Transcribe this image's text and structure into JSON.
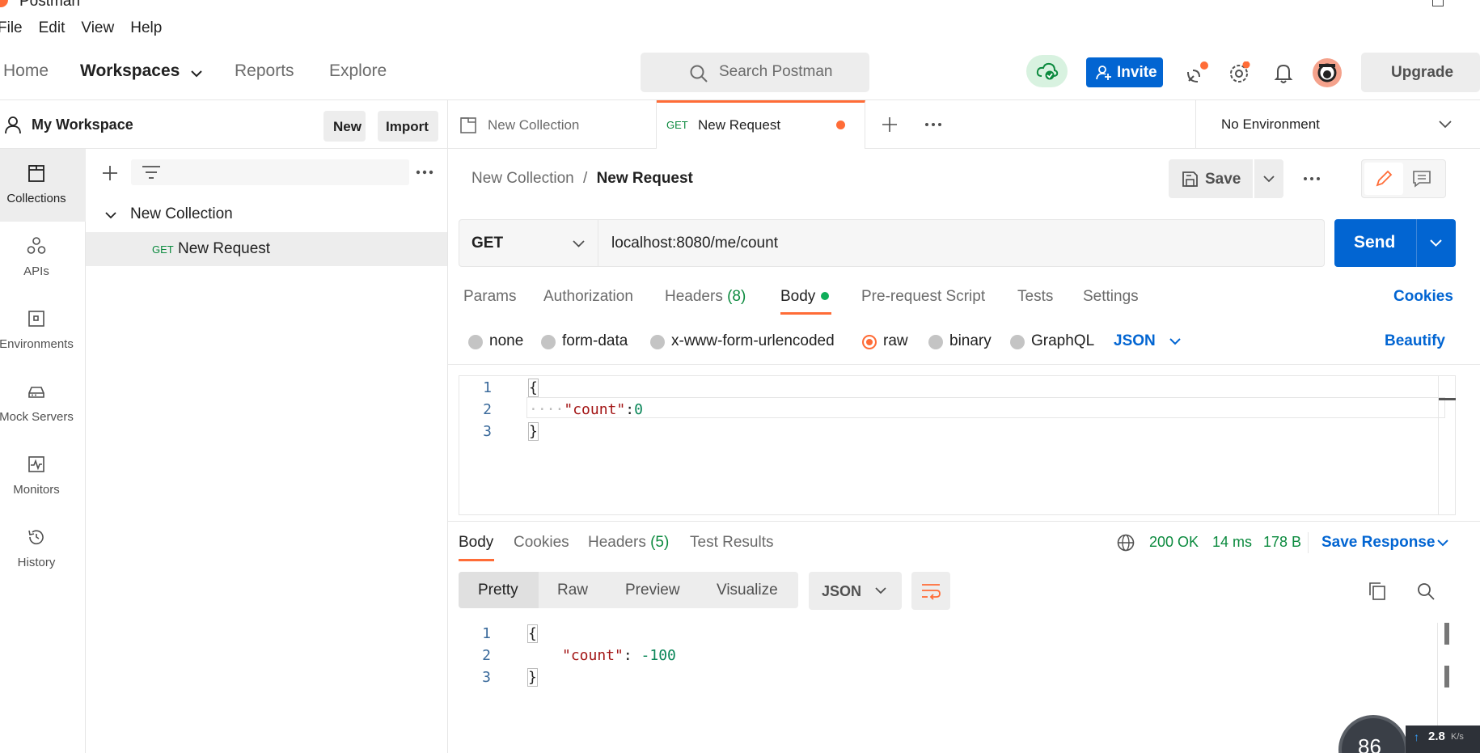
{
  "app": {
    "title": "Postman"
  },
  "menu": [
    "File",
    "Edit",
    "View",
    "Help"
  ],
  "header": {
    "nav": {
      "home": "Home",
      "workspaces": "Workspaces",
      "reports": "Reports",
      "explore": "Explore"
    },
    "search_placeholder": "Search Postman",
    "invite_label": "Invite",
    "upgrade_label": "Upgrade"
  },
  "workspace": {
    "name": "My Workspace",
    "new_label": "New",
    "import_label": "Import"
  },
  "rail": {
    "collections": "Collections",
    "apis": "APIs",
    "environments": "Environments",
    "mock_servers": "Mock Servers",
    "monitors": "Monitors",
    "history": "History"
  },
  "tree": {
    "collection": "New Collection",
    "request_method": "GET",
    "request_name": "New Request"
  },
  "tabs": {
    "tab1": "New Collection",
    "tab2_method": "GET",
    "tab2": "New Request",
    "environment": "No Environment"
  },
  "request": {
    "breadcrumb_parent": "New Collection",
    "breadcrumb_sep": "/",
    "breadcrumb_current": "New Request",
    "save_label": "Save",
    "method": "GET",
    "url": "localhost:8080/me/count",
    "send_label": "Send",
    "subtabs": {
      "params": "Params",
      "authorization": "Authorization",
      "headers": "Headers",
      "headers_count": "(8)",
      "body": "Body",
      "pre_request": "Pre-request Script",
      "tests": "Tests",
      "settings": "Settings"
    },
    "cookies_link": "Cookies",
    "body_types": {
      "none": "none",
      "form_data": "form-data",
      "urlencoded": "x-www-form-urlencoded",
      "raw": "raw",
      "binary": "binary",
      "graphql": "GraphQL"
    },
    "raw_format": "JSON",
    "beautify_link": "Beautify",
    "body_lines": {
      "n1": "1",
      "n2": "2",
      "n3": "3",
      "l1": "{",
      "l2_indent": "····",
      "l2_key": "\"count\"",
      "l2_colon": ":",
      "l2_val": "0",
      "l3": "}"
    }
  },
  "response": {
    "tabs": {
      "body": "Body",
      "cookies": "Cookies",
      "headers": "Headers",
      "headers_count": "(5)",
      "test_results": "Test Results"
    },
    "status": "200 OK",
    "time": "14 ms",
    "size": "178 B",
    "save_response": "Save Response",
    "views": {
      "pretty": "Pretty",
      "raw": "Raw",
      "preview": "Preview",
      "visualize": "Visualize"
    },
    "format": "JSON",
    "body_lines": {
      "n1": "1",
      "n2": "2",
      "n3": "3",
      "l1": "{",
      "l2_key": "\"count\"",
      "l2_colon": ": ",
      "l2_val": "-100",
      "l3": "}"
    }
  },
  "overlay": {
    "gauge": "86",
    "speed": "2.8",
    "speed_unit": "K/s"
  },
  "colors": {
    "accent": "#ff6c37",
    "primary": "#0265d2",
    "success": "#0b8a3e"
  }
}
